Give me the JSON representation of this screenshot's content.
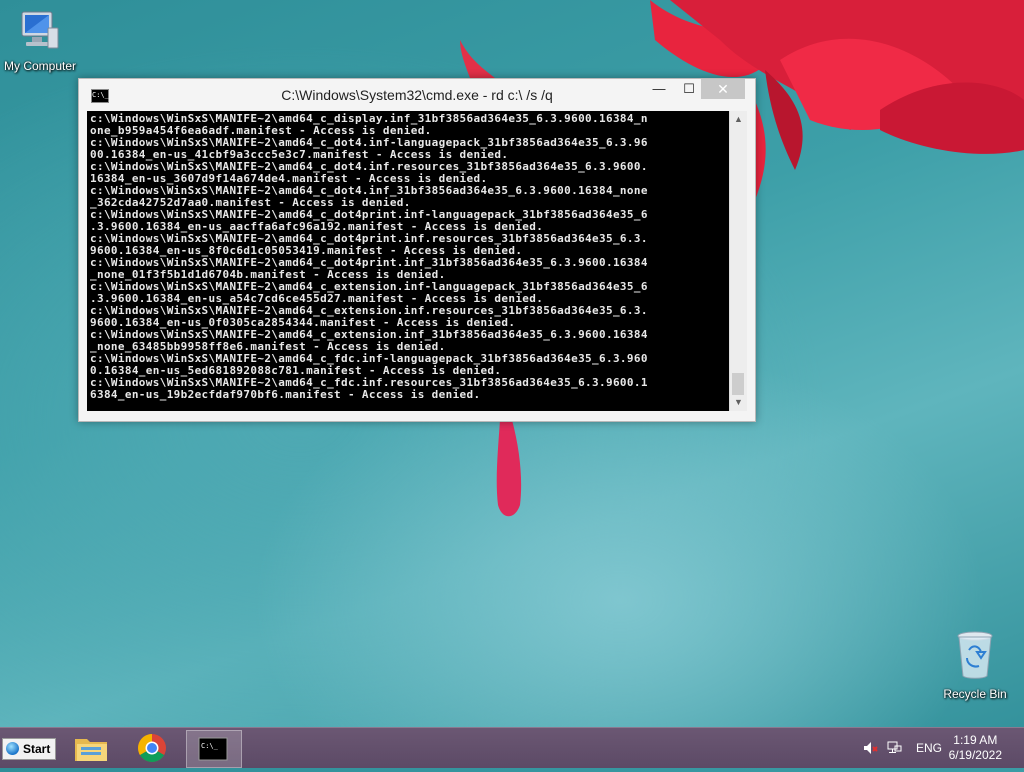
{
  "desktop": {
    "icons": [
      {
        "label": "My Computer"
      },
      {
        "label": "Recycle Bin"
      }
    ]
  },
  "window": {
    "title": "C:\\Windows\\System32\\cmd.exe - rd  c:\\ /s /q",
    "controls": {
      "minimize": "—",
      "maximize": "☐",
      "close": "✕"
    },
    "console_lines": [
      "c:\\Windows\\WinSxS\\MANIFE~2\\amd64_c_display.inf_31bf3856ad364e35_6.3.9600.16384_n",
      "one_b959a454f6ea6adf.manifest - Access is denied.",
      "c:\\Windows\\WinSxS\\MANIFE~2\\amd64_c_dot4.inf-languagepack_31bf3856ad364e35_6.3.96",
      "00.16384_en-us_41cbf9a3ccc5e3c7.manifest - Access is denied.",
      "c:\\Windows\\WinSxS\\MANIFE~2\\amd64_c_dot4.inf.resources_31bf3856ad364e35_6.3.9600.",
      "16384_en-us_3607d9f14a674de4.manifest - Access is denied.",
      "c:\\Windows\\WinSxS\\MANIFE~2\\amd64_c_dot4.inf_31bf3856ad364e35_6.3.9600.16384_none",
      "_362cda42752d7aa0.manifest - Access is denied.",
      "c:\\Windows\\WinSxS\\MANIFE~2\\amd64_c_dot4print.inf-languagepack_31bf3856ad364e35_6",
      ".3.9600.16384_en-us_aacffa6afc96a192.manifest - Access is denied.",
      "c:\\Windows\\WinSxS\\MANIFE~2\\amd64_c_dot4print.inf.resources_31bf3856ad364e35_6.3.",
      "9600.16384_en-us_8f0c6d1c05053419.manifest - Access is denied.",
      "c:\\Windows\\WinSxS\\MANIFE~2\\amd64_c_dot4print.inf_31bf3856ad364e35_6.3.9600.16384",
      "_none_01f3f5b1d1d6704b.manifest - Access is denied.",
      "c:\\Windows\\WinSxS\\MANIFE~2\\amd64_c_extension.inf-languagepack_31bf3856ad364e35_6",
      ".3.9600.16384_en-us_a54c7cd6ce455d27.manifest - Access is denied.",
      "c:\\Windows\\WinSxS\\MANIFE~2\\amd64_c_extension.inf.resources_31bf3856ad364e35_6.3.",
      "9600.16384_en-us_0f0305ca2854344.manifest - Access is denied.",
      "c:\\Windows\\WinSxS\\MANIFE~2\\amd64_c_extension.inf_31bf3856ad364e35_6.3.9600.16384",
      "_none_63485bb9958ff8e6.manifest - Access is denied.",
      "c:\\Windows\\WinSxS\\MANIFE~2\\amd64_c_fdc.inf-languagepack_31bf3856ad364e35_6.3.960",
      "0.16384_en-us_5ed681892088c781.manifest - Access is denied.",
      "c:\\Windows\\WinSxS\\MANIFE~2\\amd64_c_fdc.inf.resources_31bf3856ad364e35_6.3.9600.1",
      "6384_en-us_19b2ecfdaf970bf6.manifest - Access is denied."
    ]
  },
  "taskbar": {
    "start_label": "Start",
    "apps": [
      {
        "icon": "file-explorer-icon"
      },
      {
        "icon": "chrome-icon"
      },
      {
        "icon": "cmd-icon",
        "active": true
      }
    ],
    "tray": {
      "language": "ENG",
      "time": "1:19 AM",
      "date": "6/19/2022",
      "icons": [
        "volume-muted-icon",
        "network-icon"
      ]
    }
  },
  "colors": {
    "taskbar": "#5f4c69",
    "console_bg": "#000000",
    "console_fg": "#e8e8e8",
    "flower": "#e0203c"
  }
}
